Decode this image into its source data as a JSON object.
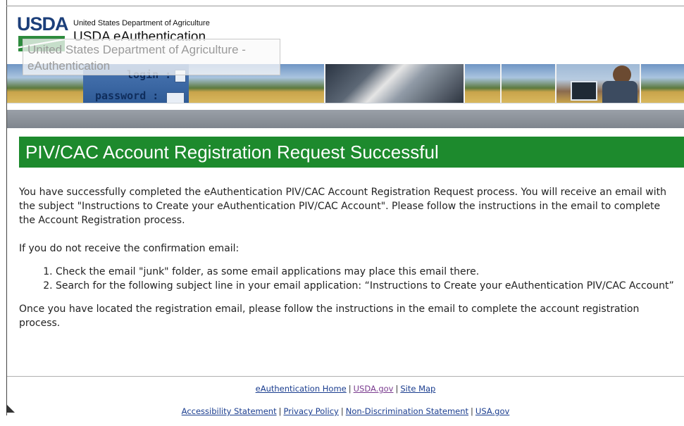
{
  "header": {
    "logo_text": "USDA",
    "department": "United States Department of Agriculture",
    "app_title": "USDA eAuthentication",
    "tooltip": "United States Department of Agriculture - eAuthentication",
    "banner_login_text": "login :",
    "banner_password_text": "password :"
  },
  "main": {
    "title": "PIV/CAC Account Registration Request Successful",
    "paragraph1": "You have successfully completed the eAuthentication PIV/CAC Account Registration Request process. You will receive an email with the subject \"Instructions to Create your eAuthentication PIV/CAC Account\". Please follow the instructions in the email to complete the Account Registration process.",
    "paragraph2": "If you do not receive the confirmation email:",
    "steps": [
      "Check the email \"junk\" folder, as some email applications may place this email there.",
      "Search for the following subject line in your email application: “Instructions to Create your eAuthentication PIV/CAC Account”"
    ],
    "paragraph3": "Once you have located the registration email, please follow the instructions in the email to complete the account registration process."
  },
  "footer": {
    "row1": [
      "eAuthentication Home",
      "USDA.gov",
      "Site Map"
    ],
    "row2": [
      "Accessibility Statement",
      "Privacy Policy",
      "Non-Discrimination Statement",
      "USA.gov"
    ],
    "separator": "|"
  },
  "colors": {
    "title_bar": "#1d8a2d",
    "link": "#1a3d8f",
    "visited_link": "#7a3b8f",
    "grey_bar": "#8a9098"
  }
}
